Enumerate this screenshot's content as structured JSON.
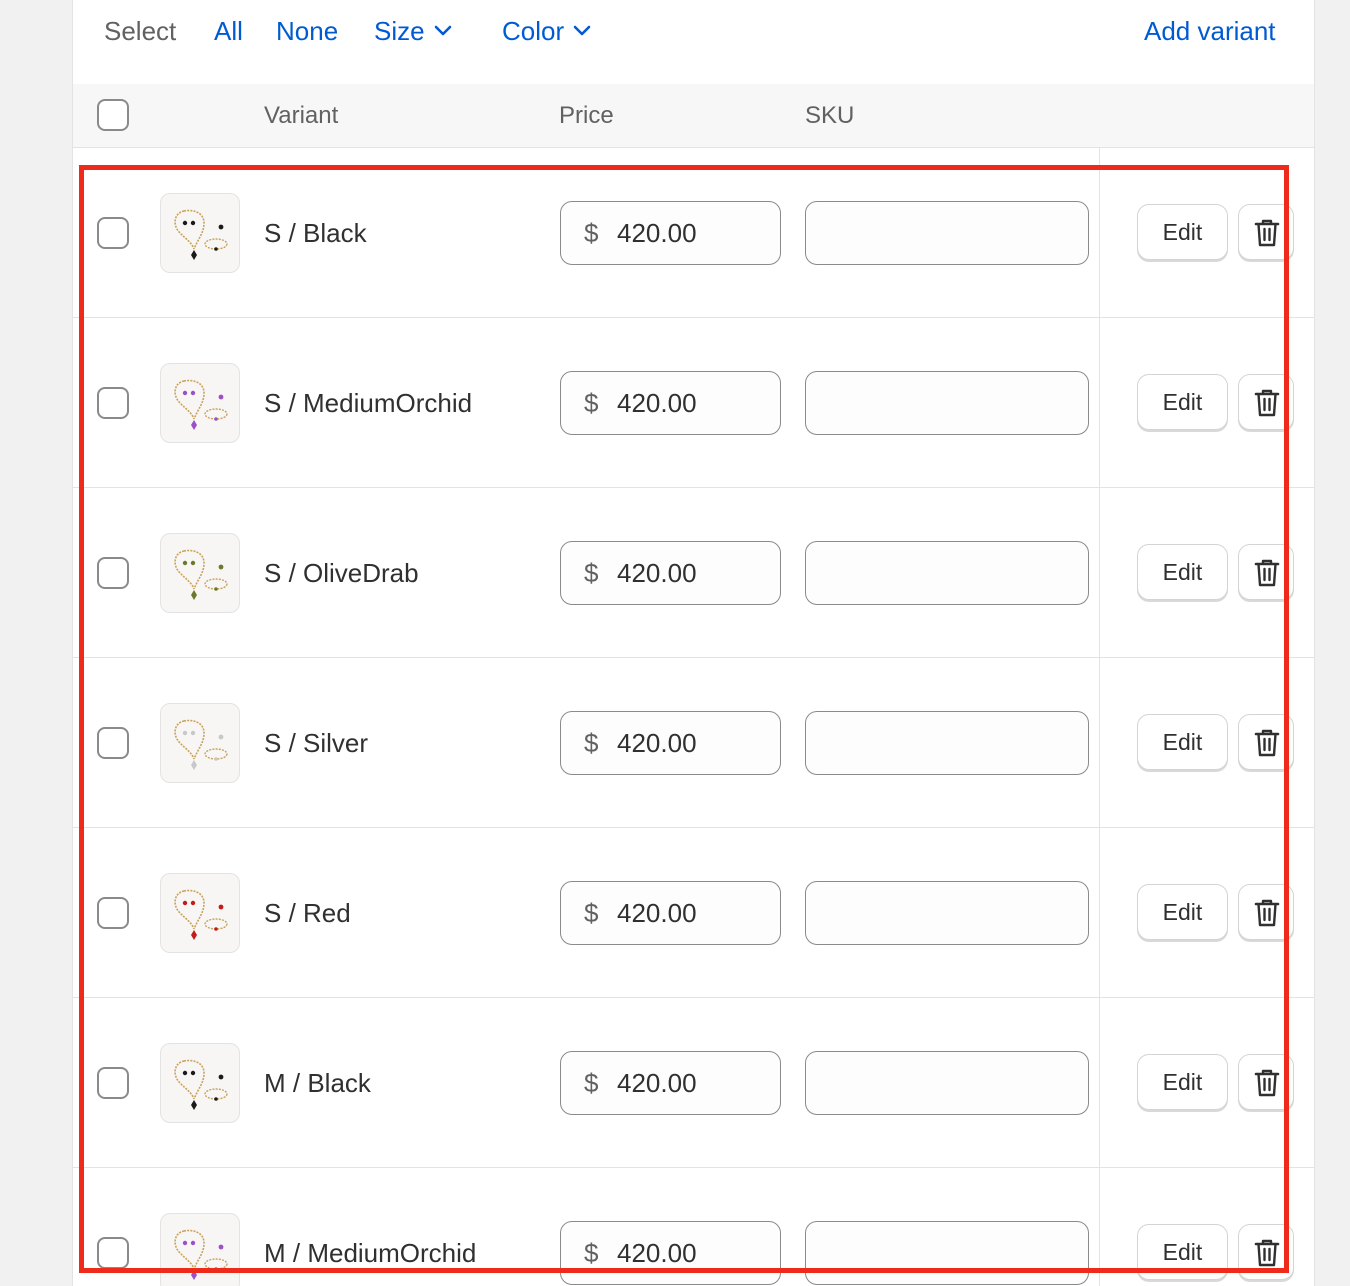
{
  "toolbar": {
    "select_label": "Select",
    "all_label": "All",
    "none_label": "None",
    "size_label": "Size",
    "color_label": "Color",
    "add_variant_label": "Add variant",
    "link_color": "#005bd3"
  },
  "table": {
    "headers": {
      "variant": "Variant",
      "price": "Price",
      "sku": "SKU"
    },
    "rows": [
      {
        "name": "S / Black",
        "currency": "$",
        "price": "420.00",
        "sku": "",
        "edit_label": "Edit",
        "gem_color": "#1a1a1a",
        "icon": "trash-icon"
      },
      {
        "name": "S / MediumOrchid",
        "currency": "$",
        "price": "420.00",
        "sku": "",
        "edit_label": "Edit",
        "gem_color": "#9b4fc9",
        "icon": "trash-icon"
      },
      {
        "name": "S / OliveDrab",
        "currency": "$",
        "price": "420.00",
        "sku": "",
        "edit_label": "Edit",
        "gem_color": "#6b7a2a",
        "icon": "trash-icon"
      },
      {
        "name": "S / Silver",
        "currency": "$",
        "price": "420.00",
        "sku": "",
        "edit_label": "Edit",
        "gem_color": "#c8c8c8",
        "icon": "trash-icon"
      },
      {
        "name": "S / Red",
        "currency": "$",
        "price": "420.00",
        "sku": "",
        "edit_label": "Edit",
        "gem_color": "#c41a1a",
        "icon": "trash-icon"
      },
      {
        "name": "M / Black",
        "currency": "$",
        "price": "420.00",
        "sku": "",
        "edit_label": "Edit",
        "gem_color": "#1a1a1a",
        "icon": "trash-icon"
      },
      {
        "name": "M / MediumOrchid",
        "currency": "$",
        "price": "420.00",
        "sku": "",
        "edit_label": "Edit",
        "gem_color": "#9b4fc9",
        "icon": "trash-icon"
      }
    ]
  },
  "highlight_color": "#ee2a1b"
}
